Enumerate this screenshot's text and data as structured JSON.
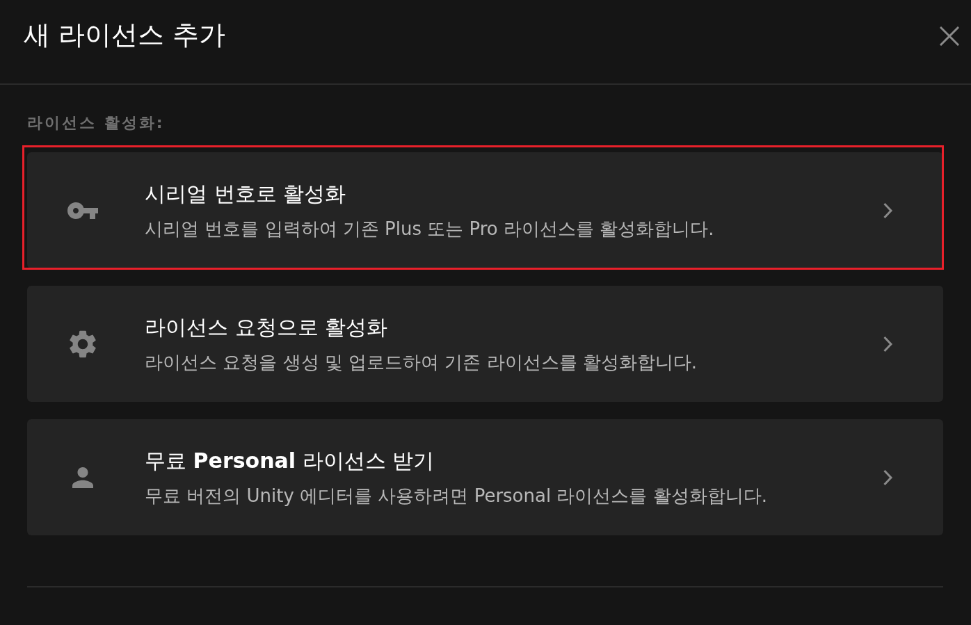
{
  "dialog": {
    "title": "새 라이선스 추가"
  },
  "section_label": "라이선스 활성화:",
  "options": [
    {
      "kind": "key",
      "title": "시리얼 번호로 활성화",
      "description": "시리얼 번호를 입력하여 기존 Plus 또는 Pro 라이선스를 활성화합니다.",
      "highlighted": true
    },
    {
      "kind": "gear",
      "title": "라이선스 요청으로 활성화",
      "description": "라이선스 요청을 생성 및 업로드하여 기존 라이선스를 활성화합니다.",
      "highlighted": false
    },
    {
      "kind": "person",
      "title": "무료 **Personal** 라이선스 받기",
      "description": "무료 버전의 Unity 에디터를 사용하려면 Personal 라이선스를 활성화합니다.",
      "highlighted": false
    }
  ]
}
